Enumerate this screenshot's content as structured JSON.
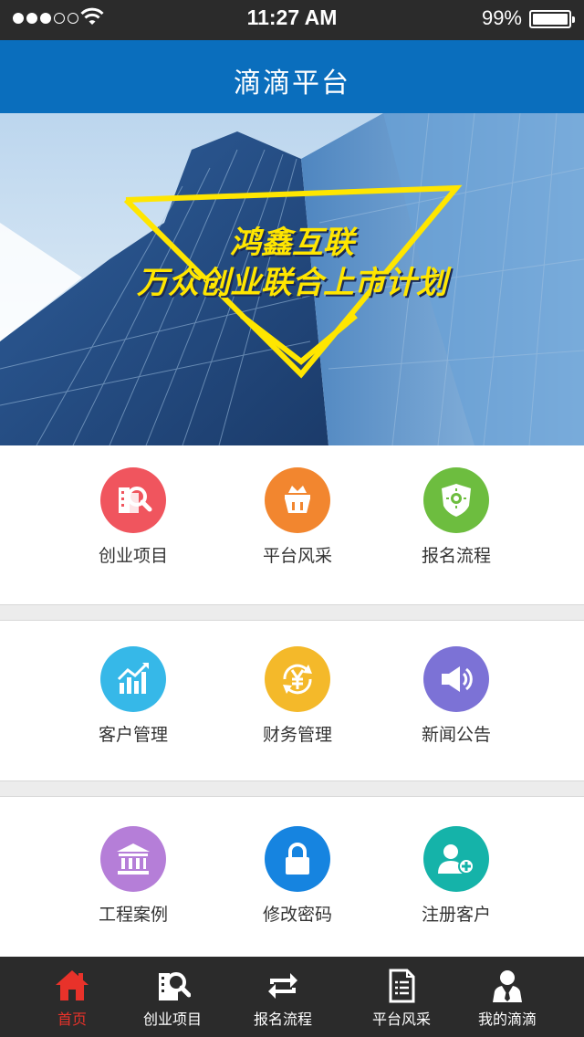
{
  "status_bar": {
    "time": "11:27 AM",
    "battery": "99%",
    "battery_level": 0.99
  },
  "nav": {
    "title": "滴滴平台"
  },
  "banner": {
    "line1": "鸿鑫互联",
    "line2": "万众创业联合上市计划"
  },
  "grid": [
    {
      "label": "创业项目",
      "icon": "project-search-icon",
      "color": "#f0555e"
    },
    {
      "label": "平台风采",
      "icon": "trophy-icon",
      "color": "#f2862f"
    },
    {
      "label": "报名流程",
      "icon": "shield-icon",
      "color": "#6dbd3f"
    },
    {
      "label": "客户管理",
      "icon": "chart-icon",
      "color": "#36b8e8"
    },
    {
      "label": "财务管理",
      "icon": "yen-icon",
      "color": "#f4b92a"
    },
    {
      "label": "新闻公告",
      "icon": "speaker-icon",
      "color": "#7c72d6"
    },
    {
      "label": "工程案例",
      "icon": "bank-icon",
      "color": "#b57ed8"
    },
    {
      "label": "修改密码",
      "icon": "lock-icon",
      "color": "#1684e0"
    },
    {
      "label": "注册客户",
      "icon": "add-user-icon",
      "color": "#15b3a9"
    }
  ],
  "tabs": [
    {
      "label": "首页",
      "icon": "home-icon",
      "active": true
    },
    {
      "label": "创业项目",
      "icon": "project-search-icon"
    },
    {
      "label": "报名流程",
      "icon": "swap-icon"
    },
    {
      "label": "平台风采",
      "icon": "document-icon"
    },
    {
      "label": "我的滴滴",
      "icon": "user-icon"
    }
  ],
  "colors": {
    "nav": "#0a6ebd",
    "status_bar": "#2b2b2b",
    "tab_active": "#e8322a",
    "banner_accent": "#ffe600"
  }
}
